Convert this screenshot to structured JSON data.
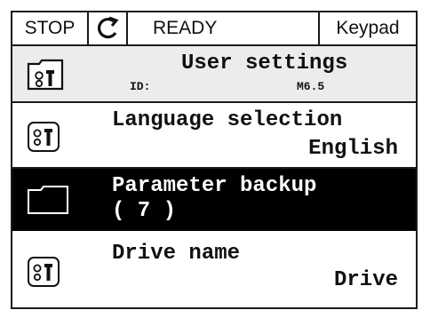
{
  "status_bar": {
    "state_left": "STOP",
    "state_mid": "READY",
    "control_place": "Keypad",
    "rotation_icon": "rotation-arrow-icon"
  },
  "header": {
    "title": "User settings",
    "id_label": "ID:",
    "id_value": "M6.5",
    "icon": "folder-keypad-icon"
  },
  "items": [
    {
      "title": "Language selection",
      "value": "English",
      "icon": "keypad-param-icon",
      "selected": false
    },
    {
      "title": "Parameter backup",
      "value": "( 7 )",
      "icon": "folder-icon",
      "selected": true
    },
    {
      "title": "Drive name",
      "value": "Drive",
      "icon": "keypad-param-icon",
      "selected": false
    }
  ],
  "colors": {
    "selected_bg": "#000000",
    "header_bg": "#ececec",
    "border": "#1a1a1a"
  }
}
